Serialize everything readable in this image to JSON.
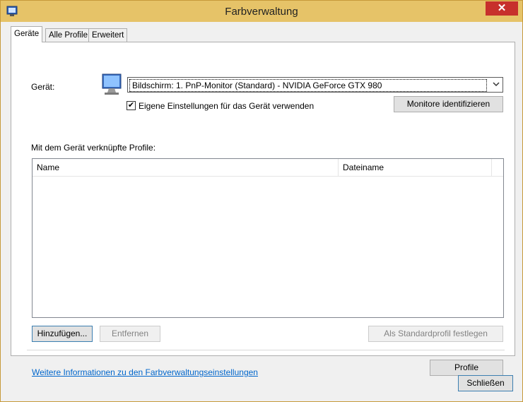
{
  "window": {
    "title": "Farbverwaltung",
    "close_symbol": "✕"
  },
  "tabs": [
    {
      "label": "Geräte",
      "active": true
    },
    {
      "label": "Alle Profile",
      "active": false
    },
    {
      "label": "Erweitert",
      "active": false
    }
  ],
  "device": {
    "label": "Gerät:",
    "selected": "Bildschirm: 1. PnP-Monitor (Standard) - NVIDIA GeForce GTX 980",
    "dropdown_icon": "chevron-down-icon",
    "use_own_settings_label": "Eigene Einstellungen für das Gerät verwenden",
    "use_own_settings_checked": true,
    "identify_button": "Monitore identifizieren"
  },
  "profiles": {
    "label": "Mit dem Gerät verknüpfte Profile:",
    "columns": [
      "Name",
      "Dateiname"
    ],
    "rows": []
  },
  "actions": {
    "add": "Hinzufügen...",
    "remove": "Entfernen",
    "set_default": "Als Standardprofil festlegen"
  },
  "footer": {
    "more_info_link": "Weitere Informationen zu den Farbverwaltungseinstellungen",
    "profile_button": "Profile"
  },
  "close_button": "Schließen",
  "colors": {
    "title_bar": "#e6c368",
    "close_button": "#c7302c",
    "link": "#0066cc"
  }
}
